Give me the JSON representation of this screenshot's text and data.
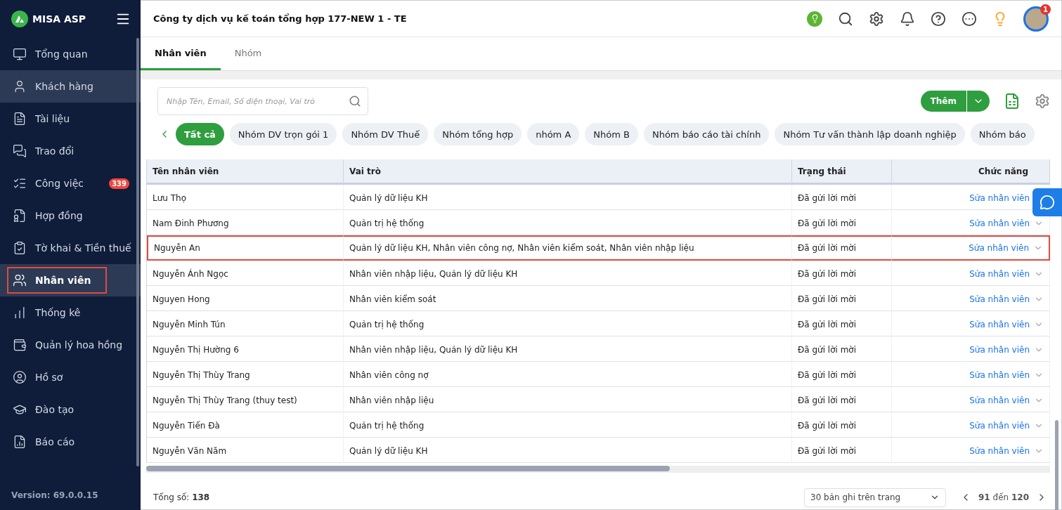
{
  "sidebar": {
    "brand": "MISA ASP",
    "items": [
      {
        "label": "Tổng quan",
        "selected": false,
        "hovered": false
      },
      {
        "label": "Khách hàng",
        "selected": false,
        "hovered": true
      },
      {
        "label": "Tài liệu",
        "selected": false,
        "hovered": false
      },
      {
        "label": "Trao đổi",
        "selected": false,
        "hovered": false
      },
      {
        "label": "Công việc",
        "selected": false,
        "hovered": false,
        "badge": "339"
      },
      {
        "label": "Hợp đồng",
        "selected": false,
        "hovered": false
      },
      {
        "label": "Tờ khai & Tiền thuế",
        "selected": false,
        "hovered": false
      },
      {
        "label": "Nhân viên",
        "selected": true,
        "hovered": false,
        "highlighted": true
      },
      {
        "label": "Thống kê",
        "selected": false,
        "hovered": false
      },
      {
        "label": "Quản lý hoa hồng",
        "selected": false,
        "hovered": false
      },
      {
        "label": "Hồ sơ",
        "selected": false,
        "hovered": false
      },
      {
        "label": "Đào tạo",
        "selected": false,
        "hovered": false
      },
      {
        "label": "Báo cáo",
        "selected": false,
        "hovered": false
      }
    ],
    "version": "Version: 69.0.0.15"
  },
  "header": {
    "title": "Công ty dịch vụ kế toán tổng hợp 177-NEW 1 - TE",
    "notification_count": "1"
  },
  "tabs": [
    {
      "label": "Nhân viên",
      "selected": true
    },
    {
      "label": "Nhóm",
      "selected": false
    }
  ],
  "search": {
    "placeholder": "Nhập Tên, Email, Số điện thoại, Vai trò"
  },
  "add_button": "Thêm",
  "filters": [
    {
      "label": "Tất cả",
      "selected": true
    },
    {
      "label": "Nhóm DV trọn gói 1",
      "selected": false
    },
    {
      "label": "Nhóm DV Thuế",
      "selected": false
    },
    {
      "label": "Nhóm tổng hợp",
      "selected": false
    },
    {
      "label": "nhóm A",
      "selected": false
    },
    {
      "label": "Nhóm B",
      "selected": false
    },
    {
      "label": "Nhóm báo cáo tài chính",
      "selected": false
    },
    {
      "label": "Nhóm Tư vấn thành lập doanh nghiệp",
      "selected": false
    },
    {
      "label": "Nhóm báo",
      "selected": false
    }
  ],
  "table": {
    "columns": [
      "Tên nhân viên",
      "Vai trò",
      "Trạng thái",
      "Chức năng"
    ],
    "rows": [
      {
        "name": "Lưu Thọ",
        "role": "Quản lý dữ liệu KH",
        "status": "Đã gửi lời mời",
        "action": "Sửa nhân viên",
        "highlighted": false
      },
      {
        "name": "Nam Đinh Phương",
        "role": "Quản trị hệ thống",
        "status": "Đã gửi lời mời",
        "action": "Sửa nhân viên",
        "highlighted": false
      },
      {
        "name": "Nguyễn An",
        "role": "Quản lý dữ liệu KH, Nhân viên công nợ, Nhân viên kiểm soát, Nhân viên nhập liệu",
        "status": "Đã gửi lời mời",
        "action": "Sửa nhân viên",
        "highlighted": true
      },
      {
        "name": "Nguyễn Ánh Ngọc",
        "role": "Nhân viên nhập liệu, Quản lý dữ liệu KH",
        "status": "Đã gửi lời mời",
        "action": "Sửa nhân viên",
        "highlighted": false
      },
      {
        "name": "Nguyen Hong",
        "role": "Nhân viên kiểm soát",
        "status": "Đã gửi lời mời",
        "action": "Sửa nhân viên",
        "highlighted": false
      },
      {
        "name": "Nguyễn Minh Tún",
        "role": "Quản trị hệ thống",
        "status": "Đã gửi lời mời",
        "action": "Sửa nhân viên",
        "highlighted": false
      },
      {
        "name": "Nguyễn Thị Hường 6",
        "role": "Nhân viên nhập liệu, Quản lý dữ liệu KH",
        "status": "Đã gửi lời mời",
        "action": "Sửa nhân viên",
        "highlighted": false
      },
      {
        "name": "Nguyễn Thị Thùy Trang",
        "role": "Nhân viên công nợ",
        "status": "Đã gửi lời mời",
        "action": "Sửa nhân viên",
        "highlighted": false
      },
      {
        "name": "Nguyễn Thị Thùy Trang (thuy test)",
        "role": "Nhân viên nhập liệu",
        "status": "Đã gửi lời mời",
        "action": "Sửa nhân viên",
        "highlighted": false
      },
      {
        "name": "Nguyễn Tiến Đà",
        "role": "Quản trị hệ thống",
        "status": "Đã gửi lời mời",
        "action": "Sửa nhân viên",
        "highlighted": false
      },
      {
        "name": "Nguyễn Văn Năm",
        "role": "Quản lý dữ liệu KH",
        "status": "Đã gửi lời mời",
        "action": "Sửa nhân viên",
        "highlighted": false
      }
    ]
  },
  "footer": {
    "total": "Tổng số: **138**",
    "page_size": "30 bản ghi trên trang",
    "range": "**91** đến **120**"
  }
}
